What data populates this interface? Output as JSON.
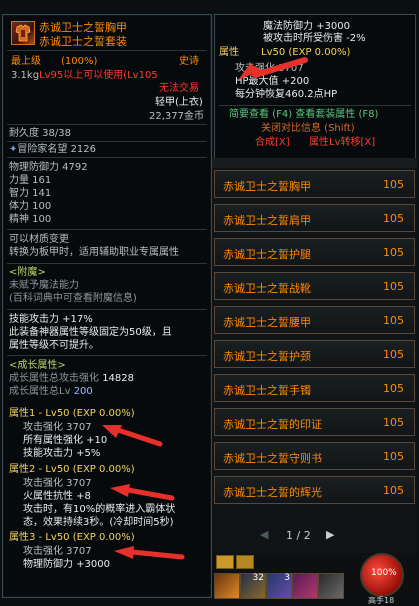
{
  "tooltip": {
    "title": "赤诚卫士之誓胸甲",
    "subtitle": "赤诚卫士之誓套装",
    "level_req": "最上级",
    "rarity_pct": "(100%)",
    "rarity": "史诗",
    "weight": "3.1kg",
    "lv_req": "Lv95以上可以使用(Lv105",
    "untradeable": "无法交易",
    "armor_type": "轻甲(上衣)",
    "price": "22,377金币",
    "durability": "耐久度 38/38",
    "reputation": "冒险家名望 2126",
    "phys_def": "物理防御力 4792",
    "str": "力量 161",
    "int": "智力 141",
    "vit": "体力 100",
    "spi": "精神 100",
    "transform_1": "可以材质变更",
    "transform_2": "转换为板甲时，适用辅助职业专属属性",
    "enchant_head": "<附魔>",
    "enchant_none": "未赋予魔法能力",
    "enchant_hint": "(百科词典中可查看附魔信息)",
    "skill_atk": "技能攻击力 +17%",
    "skill_note_1": "此装备神器属性等级固定为50级，且",
    "skill_note_2": "属性等级不可提升。",
    "growth_head": "<成长属性>",
    "growth_total_atk_label": "成长属性总攻击强化",
    "growth_total_atk": "14828",
    "growth_total_lv_label": "成长属性总Lv",
    "growth_total_lv": "200",
    "attr1_head": "属性1 - Lv50 (EXP 0.00%)",
    "attr1_atk": "攻击强化 3707",
    "attr1_elem": "所有属性强化 +10",
    "attr1_skill": "技能攻击力 +5%",
    "attr2_head": "属性2 - Lv50 (EXP 0.00%)",
    "attr2_atk": "攻击强化 3707",
    "attr2_fire": "火属性抗性 +8",
    "attr2_proc_1": "攻击时，有10%的概率进入霸体状",
    "attr2_proc_2": "态，效果持续3秒。(冷却时间5秒)",
    "attr3_head": "属性3 - Lv50 (EXP 0.00%)",
    "attr3_atk": "攻击强化 3707",
    "attr3_def": "物理防御力 +3000"
  },
  "set_tooltip": {
    "mag_def": "魔法防御力 +3000",
    "dmg_reduce": "被攻击时所受伤害 -2%",
    "attr_head_prefix": "属性",
    "attr_head_rest": "Lv50 (EXP 0.00%)",
    "atk": "攻击强化 3707",
    "hp": "HP最大值 +200",
    "hp_regen": "每分钟恢复460.2点HP",
    "action_1": "简要查看 (F4) 查看套装属性 (F8)",
    "action_2": "关闭对比信息 (Shift)",
    "action_3a": "合成[X]",
    "action_3b": "属性Lv转移[X]"
  },
  "set_list": {
    "items": [
      {
        "name": "赤诚卫士之誓胸甲",
        "level": "105"
      },
      {
        "name": "赤诚卫士之誓肩甲",
        "level": "105"
      },
      {
        "name": "赤诚卫士之誓护腿",
        "level": "105"
      },
      {
        "name": "赤诚卫士之誓战靴",
        "level": "105"
      },
      {
        "name": "赤诚卫士之誓腰甲",
        "level": "105"
      },
      {
        "name": "赤诚卫士之誓护颈",
        "level": "105"
      },
      {
        "name": "赤诚卫士之誓手镯",
        "level": "105"
      },
      {
        "name": "赤诚卫士之誓的印证",
        "level": "105"
      },
      {
        "name": "赤诚卫士之誓守则书",
        "level": "105"
      },
      {
        "name": "赤诚卫士之誓的辉光",
        "level": "105"
      }
    ],
    "page": "1 / 2"
  },
  "hotbar": {
    "slot_count_a": "32",
    "slot_count_b": "3",
    "hp_pct": "100%",
    "player_name": "高手18"
  },
  "colors": {
    "epic_orange": "#ff8a00",
    "warn_red": "#ff3a2b",
    "arrow_red": "#e8302a"
  }
}
